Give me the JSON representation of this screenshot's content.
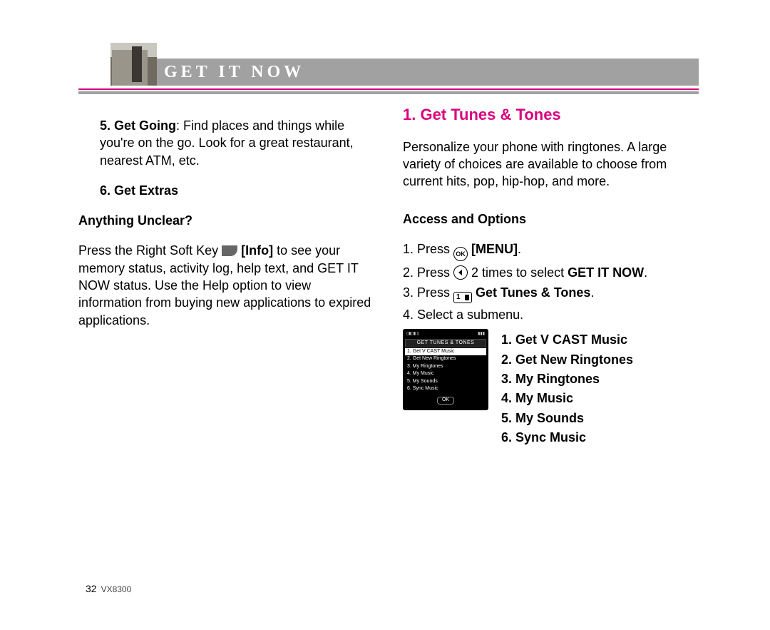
{
  "banner_title": "GET IT NOW",
  "left": {
    "item5_label": "5. Get Going",
    "item5_text": ": Find places and things while you're on the go. Look for a great restaurant, nearest ATM, etc.",
    "item6": "6. Get Extras",
    "anything": "Anything Unclear?",
    "unclear_a": "Press the Right Soft Key ",
    "unclear_info": " [Info]",
    "unclear_b": " to see your memory status, activity log, help text, and GET IT NOW status. Use the Help option to view information from buying new applications to expired applications."
  },
  "right": {
    "title": "1. Get Tunes & Tones",
    "intro": "Personalize your phone with ringtones.  A large variety of choices are available to choose from current hits, pop, hip-hop, and more.",
    "access_heading": "Access and Options",
    "s1a": "1. Press ",
    "s1_menu": " [MENU]",
    "s1b": ".",
    "s2a": "2. Press  ",
    "s2b": "  2 times to select ",
    "s2_gin": "GET IT NOW",
    "s2c": ".",
    "s3a": "3. Press  ",
    "s3_tt": " Get Tunes & Tones",
    "s3b": ".",
    "s4": "4. Select a submenu.",
    "screen": {
      "status_l": "▯▮▯▮ ▯",
      "status_r": "▮▮▮",
      "title": "GET TUNES & TONES",
      "i1": "1. Get V CAST Music",
      "i2": "2. Get New Ringtones",
      "i3": "3. My Ringtones",
      "i4": "4. My Music",
      "i5": "5. My Sounds",
      "i6": "6. Sync Music",
      "ok": "OK"
    },
    "sub": {
      "i1": "1. Get V CAST Music",
      "i2": "2. Get New Ringtones",
      "i3": "3. My Ringtones",
      "i4": "4. My Music",
      "i5": "5. My Sounds",
      "i6": "6. Sync Music"
    }
  },
  "footer": {
    "page": "32",
    "model": "VX8300"
  }
}
